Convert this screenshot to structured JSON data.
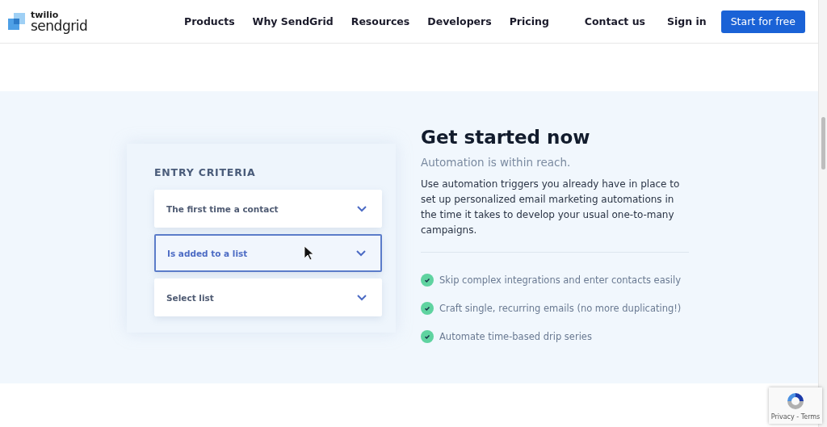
{
  "logo": {
    "top": "twilio",
    "bottom": "sendgrid"
  },
  "nav": [
    "Products",
    "Why SendGrid",
    "Resources",
    "Developers",
    "Pricing"
  ],
  "header_links": [
    "Contact us",
    "Sign in"
  ],
  "cta": "Start for free",
  "criteria": {
    "title": "ENTRY CRITERIA",
    "dropdowns": [
      {
        "label": "The first time a contact",
        "selected": false
      },
      {
        "label": "Is added to a list",
        "selected": true
      },
      {
        "label": "Select list",
        "selected": false
      }
    ]
  },
  "content": {
    "title": "Get started now",
    "subtitle": "Automation is within reach.",
    "body": "Use automation triggers you already have in place to set up personalized email marketing automations in the time it takes to develop your usual one-to-many campaigns.",
    "features": [
      "Skip complex integrations and enter contacts easily",
      "Craft single, recurring emails (no more duplicating!)",
      "Automate time-based drip series"
    ]
  },
  "recaptcha": {
    "text": "Privacy - Terms"
  }
}
